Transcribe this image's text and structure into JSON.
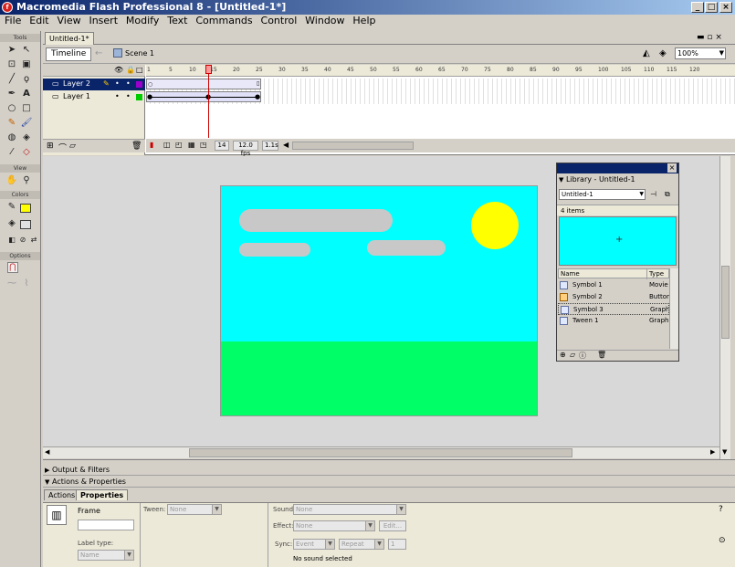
{
  "window": {
    "title": "Macromedia Flash Professional 8 - [Untitled-1*]"
  },
  "menu": [
    "File",
    "Edit",
    "View",
    "Insert",
    "Modify",
    "Text",
    "Commands",
    "Control",
    "Window",
    "Help"
  ],
  "tools": {
    "sections": {
      "tools": "Tools",
      "view": "View",
      "colors": "Colors",
      "options": "Options"
    }
  },
  "document": {
    "tab": "Untitled-1*",
    "timeline_button": "Timeline",
    "scene": "Scene 1",
    "zoom": "100%"
  },
  "timeline": {
    "layers": [
      {
        "name": "Layer 2",
        "selected": true
      },
      {
        "name": "Layer 1",
        "selected": false
      }
    ],
    "ticks": [
      "1",
      "5",
      "10",
      "15",
      "20",
      "25",
      "30",
      "35",
      "40",
      "45",
      "50",
      "55",
      "60",
      "65",
      "70",
      "75",
      "80",
      "85",
      "90",
      "95",
      "100",
      "105",
      "110",
      "115",
      "120"
    ],
    "current_frame": "14",
    "frame_rate": "12.0 fps",
    "time": "1.1s"
  },
  "stage": {
    "sky_color": "#00ffff",
    "ground_color": "#00ff66",
    "sun_color": "#ffff00",
    "cloud_color": "#c8c8c8"
  },
  "library": {
    "title": "Library - Untitled-1",
    "selector": "Untitled-1",
    "count": "4 items",
    "col_name": "Name",
    "col_type": "Type",
    "items": [
      {
        "name": "Symbol 1",
        "type": "Movie"
      },
      {
        "name": "Symbol 2",
        "type": "Button"
      },
      {
        "name": "Symbol 3",
        "type": "Graphic"
      },
      {
        "name": "Tween 1",
        "type": "Graphic"
      }
    ]
  },
  "panels": {
    "output": "Output & Filters",
    "actions": "Actions & Properties",
    "tab_actions": "Actions",
    "tab_properties": "Properties"
  },
  "properties": {
    "frame_label": "Frame",
    "tween_label": "Tween:",
    "tween_value": "None",
    "label_type": "Label type:",
    "label_type_value": "Name",
    "sound_label": "Sound:",
    "sound_value": "None",
    "effect_label": "Effect:",
    "effect_value": "None",
    "edit_button": "Edit...",
    "sync_label": "Sync:",
    "sync_value": "Event",
    "repeat_value": "Repeat",
    "repeat_count": "1",
    "no_sound": "No sound selected"
  }
}
